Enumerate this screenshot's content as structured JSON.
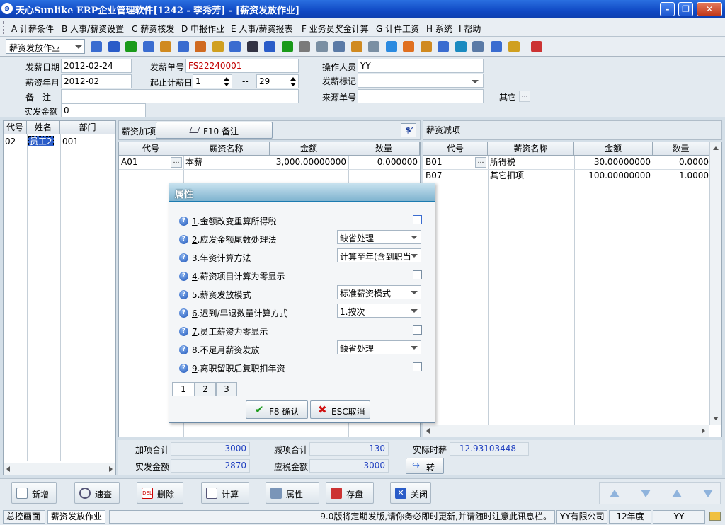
{
  "window": {
    "title": "天心Sunlike ERP企业管理软件[1242 - 李秀芳] - [薪资发放作业]",
    "app_icon": "tianxin-logo-icon"
  },
  "menu": [
    "A 计薪条件",
    "B 人事/薪资设置",
    "C 薪资核发",
    "D 申报作业",
    "E 人事/薪资报表",
    "F 业务员奖金计算",
    "G 计件工资",
    "H 系统",
    "I 帮助"
  ],
  "toolbar": {
    "module_select": "薪资发放作业"
  },
  "header": {
    "pay_date_label": "发薪日期",
    "pay_date": "2012-02-24",
    "pay_month_label": "薪资年月",
    "pay_month": "2012-02",
    "remark_label": "备　注",
    "remark": "",
    "actual_amount_label": "实发金额",
    "actual_amount": "0",
    "pay_no_label": "发薪单号",
    "pay_no": "FS22240001",
    "day_range_label": "起止计薪日",
    "day_from": "1",
    "day_sep": "--",
    "day_to": "29",
    "operator_label": "操作人员",
    "operator": "YY",
    "pay_flag_label": "发薪标记",
    "pay_flag": "",
    "source_no_label": "来源单号",
    "source_no": "",
    "other_label": "其它",
    "other_btn": "…"
  },
  "employees": {
    "columns": [
      "代号",
      "姓名",
      "部门"
    ],
    "rows": [
      {
        "code": "02",
        "name": "员工2",
        "dept": "001"
      }
    ]
  },
  "additions": {
    "title": "薪资加项",
    "f10_button": "F10 备注",
    "columns": [
      "代号",
      "薪资名称",
      "金额",
      "数量"
    ],
    "rows": [
      {
        "code": "A01",
        "name": "本薪",
        "amount": "3,000.00000000",
        "qty": "0.000000"
      }
    ]
  },
  "deductions": {
    "title": "薪资减项",
    "columns": [
      "代号",
      "薪资名称",
      "金额",
      "数量"
    ],
    "rows": [
      {
        "code": "B01",
        "name": "所得税",
        "amount": "30.00000000",
        "qty": "0.0000"
      },
      {
        "code": "B07",
        "name": "其它扣项",
        "amount": "100.00000000",
        "qty": "1.0000"
      }
    ]
  },
  "totals": {
    "add_total_label": "加项合计",
    "add_total": "3000",
    "deduct_total_label": "减项合计",
    "deduct_total": "130",
    "actual_hourly_label": "实际时薪",
    "actual_hourly": "12.93103448",
    "actual_pay_label": "实发金额",
    "actual_pay": "2870",
    "taxable_label": "应税金额",
    "taxable": "3000",
    "convert_button": "转"
  },
  "dialog": {
    "title": "属性",
    "props": [
      {
        "num": "1",
        "label": ".金额改变重算所得税",
        "type": "check",
        "value": ""
      },
      {
        "num": "2",
        "label": ".应发金额尾数处理法",
        "type": "select",
        "value": "缺省处理"
      },
      {
        "num": "3",
        "label": ".年资计算方法",
        "type": "select",
        "value": "计算至年(含到职当"
      },
      {
        "num": "4",
        "label": ".薪资项目计算为零显示",
        "type": "check",
        "value": ""
      },
      {
        "num": "5",
        "label": ".薪资发放模式",
        "type": "select",
        "value": "标准薪资模式"
      },
      {
        "num": "6",
        "label": ".迟到/早退数量计算方式",
        "type": "select",
        "value": "1.按次"
      },
      {
        "num": "7",
        "label": ".员工薪资为零显示",
        "type": "check",
        "value": ""
      },
      {
        "num": "8",
        "label": ".不足月薪资发放",
        "type": "select",
        "value": "缺省处理"
      },
      {
        "num": "9",
        "label": ".离职留职后复职扣年资",
        "type": "check",
        "value": ""
      }
    ],
    "tabs": [
      "1",
      "2",
      "3"
    ],
    "ok": "F8 确认",
    "cancel": "ESC取消"
  },
  "actions": [
    "新增",
    "速查",
    "删除",
    "计算",
    "属性",
    "存盘",
    "关闭"
  ],
  "status": {
    "home": "总控画面",
    "current": "薪资发放作业",
    "message": "9.0版将定期发版,请你务必即时更新,并请随时注意此讯息栏。",
    "company": "YY有限公司",
    "year": "12年度",
    "user": "YY"
  },
  "colors": {
    "title_blue": "#1049c4",
    "accent_red": "#c00000",
    "value_blue": "#2040c0",
    "panel_bg": "#d4dfe8"
  }
}
